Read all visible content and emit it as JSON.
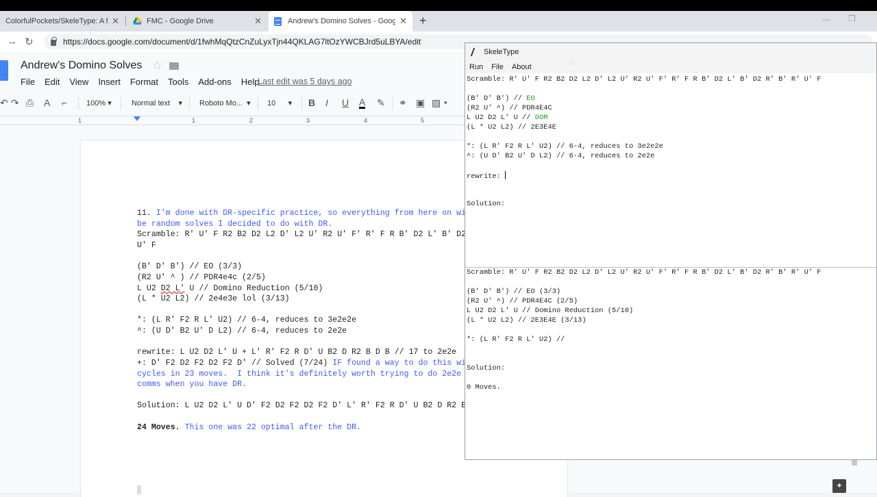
{
  "browser": {
    "tabs": [
      {
        "label": "ColorfulPockets/SkeleType: A féw"
      },
      {
        "label": "FMC - Google Drive"
      },
      {
        "label": "Andrew's Domino Solves - Goog"
      }
    ],
    "url": "https://docs.google.com/document/d/1fwhMqQtzCnZuLyxTjn44QKLAG7ltOzYWCBJrd5uLBYA/edit"
  },
  "docs": {
    "title": "Andrew's Domino Solves",
    "menu": [
      "File",
      "Edit",
      "View",
      "Insert",
      "Format",
      "Tools",
      "Add-ons",
      "Help"
    ],
    "last_edit": "Last edit was 5 days ago",
    "toolbar": {
      "zoom": "100%",
      "style": "Normal text",
      "font": "Roboto Mo...",
      "size": "10"
    },
    "ruler_ticks": [
      "1",
      "1",
      "2",
      "3",
      "4",
      "5"
    ],
    "body": {
      "l1a": "11. ",
      "l1b": "I'm done with DR-specific practice, so everything from here on wi",
      "l2": "be random solves I decided to do with DR.",
      "l3": "Scramble: R' U' F R2 B2 D2 L2 D' L2 U' R2 U' F' R' F R B' D2 L' B' D2",
      "l4": "U' F",
      "l5": "(B' D' B') // EO (3/3)",
      "l6": "(R2 U' ^ ) // PDR4e4c (2/5)",
      "l7a": "L U2 ",
      "l7b": "D2 L'",
      "l7c": " U // Domino Reduction (5/10)",
      "l8": "(L * U2 L2) // 2e4e3e lol (3/13)",
      "l9": "*: (L R' F2 R L' U2) // 6-4, reduces to 3e2e2e",
      "l10": "^: (U D' B2 U' D L2) // 6-4, reduces to 2e2e",
      "l11": "rewrite: L U2 D2 L' U + L' R' F2 R D' U B2 D R2 B D B // 17 to 2e2e",
      "l12a": "+: D' F2 D2 F2 D2 F2 D' // Solved (7/24) ",
      "l12b": "IF found a way to do this wi",
      "l13": "cycles in 23 moves.  I think it's definitely worth trying to do 2e2e",
      "l14": "comms when you have DR.",
      "l15": "Solution: L U2 D2 L' U D' F2 D2 F2 D2 F2 D' L' R' F2 R D' U B2 D R2 B",
      "l16a": "24 Moves.",
      "l16b": " This one was 22 optimal after the DR."
    }
  },
  "skeletype": {
    "title": "SkeleType",
    "menu": [
      "Run",
      "File",
      "About"
    ],
    "top": {
      "scramble": "Scramble: R' U' F R2 B2 D2 L2 D' L2 U' R2 U' F' R' F R B' D2 L' B' D2 R' B' R' U' F",
      "eo_a": "(B' D' B') // ",
      "eo_b": "EO",
      "pdr": "(R2 U' ^) // PDR4E4C",
      "dom_a": "L U2 D2 L' U // ",
      "dom_b": "DOM",
      "l4": "(L * U2 L2) // 2E3E4E",
      "star": "*: (L R' F2 R L' U2) // 6-4, reduces to 3e2e2e",
      "caret": "^: (U D' B2 U' D L2) // 6-4, reduces to 2e2e",
      "rewrite": "rewrite: ",
      "solution": "Solution:"
    },
    "bottom": {
      "scramble": "Scramble: R' U' F R2 B2 D2 L2 D' L2 U' R2 U' F' R' F R B' D2 L' B' D2 R' B' R' U' F",
      "eo": "(B' D' B') // EO (3/3)",
      "pdr": "(R2 U' ^) // PDR4E4C (2/5)",
      "dom": "L U2 D2 L' U // Domino Reduction (5/10)",
      "l4": "(L * U2 L2) // 2E3E4E (3/13)",
      "star": "*: (L R' F2 R L' U2) //",
      "solution": "Solution:",
      "moves": "0 Moves."
    }
  }
}
